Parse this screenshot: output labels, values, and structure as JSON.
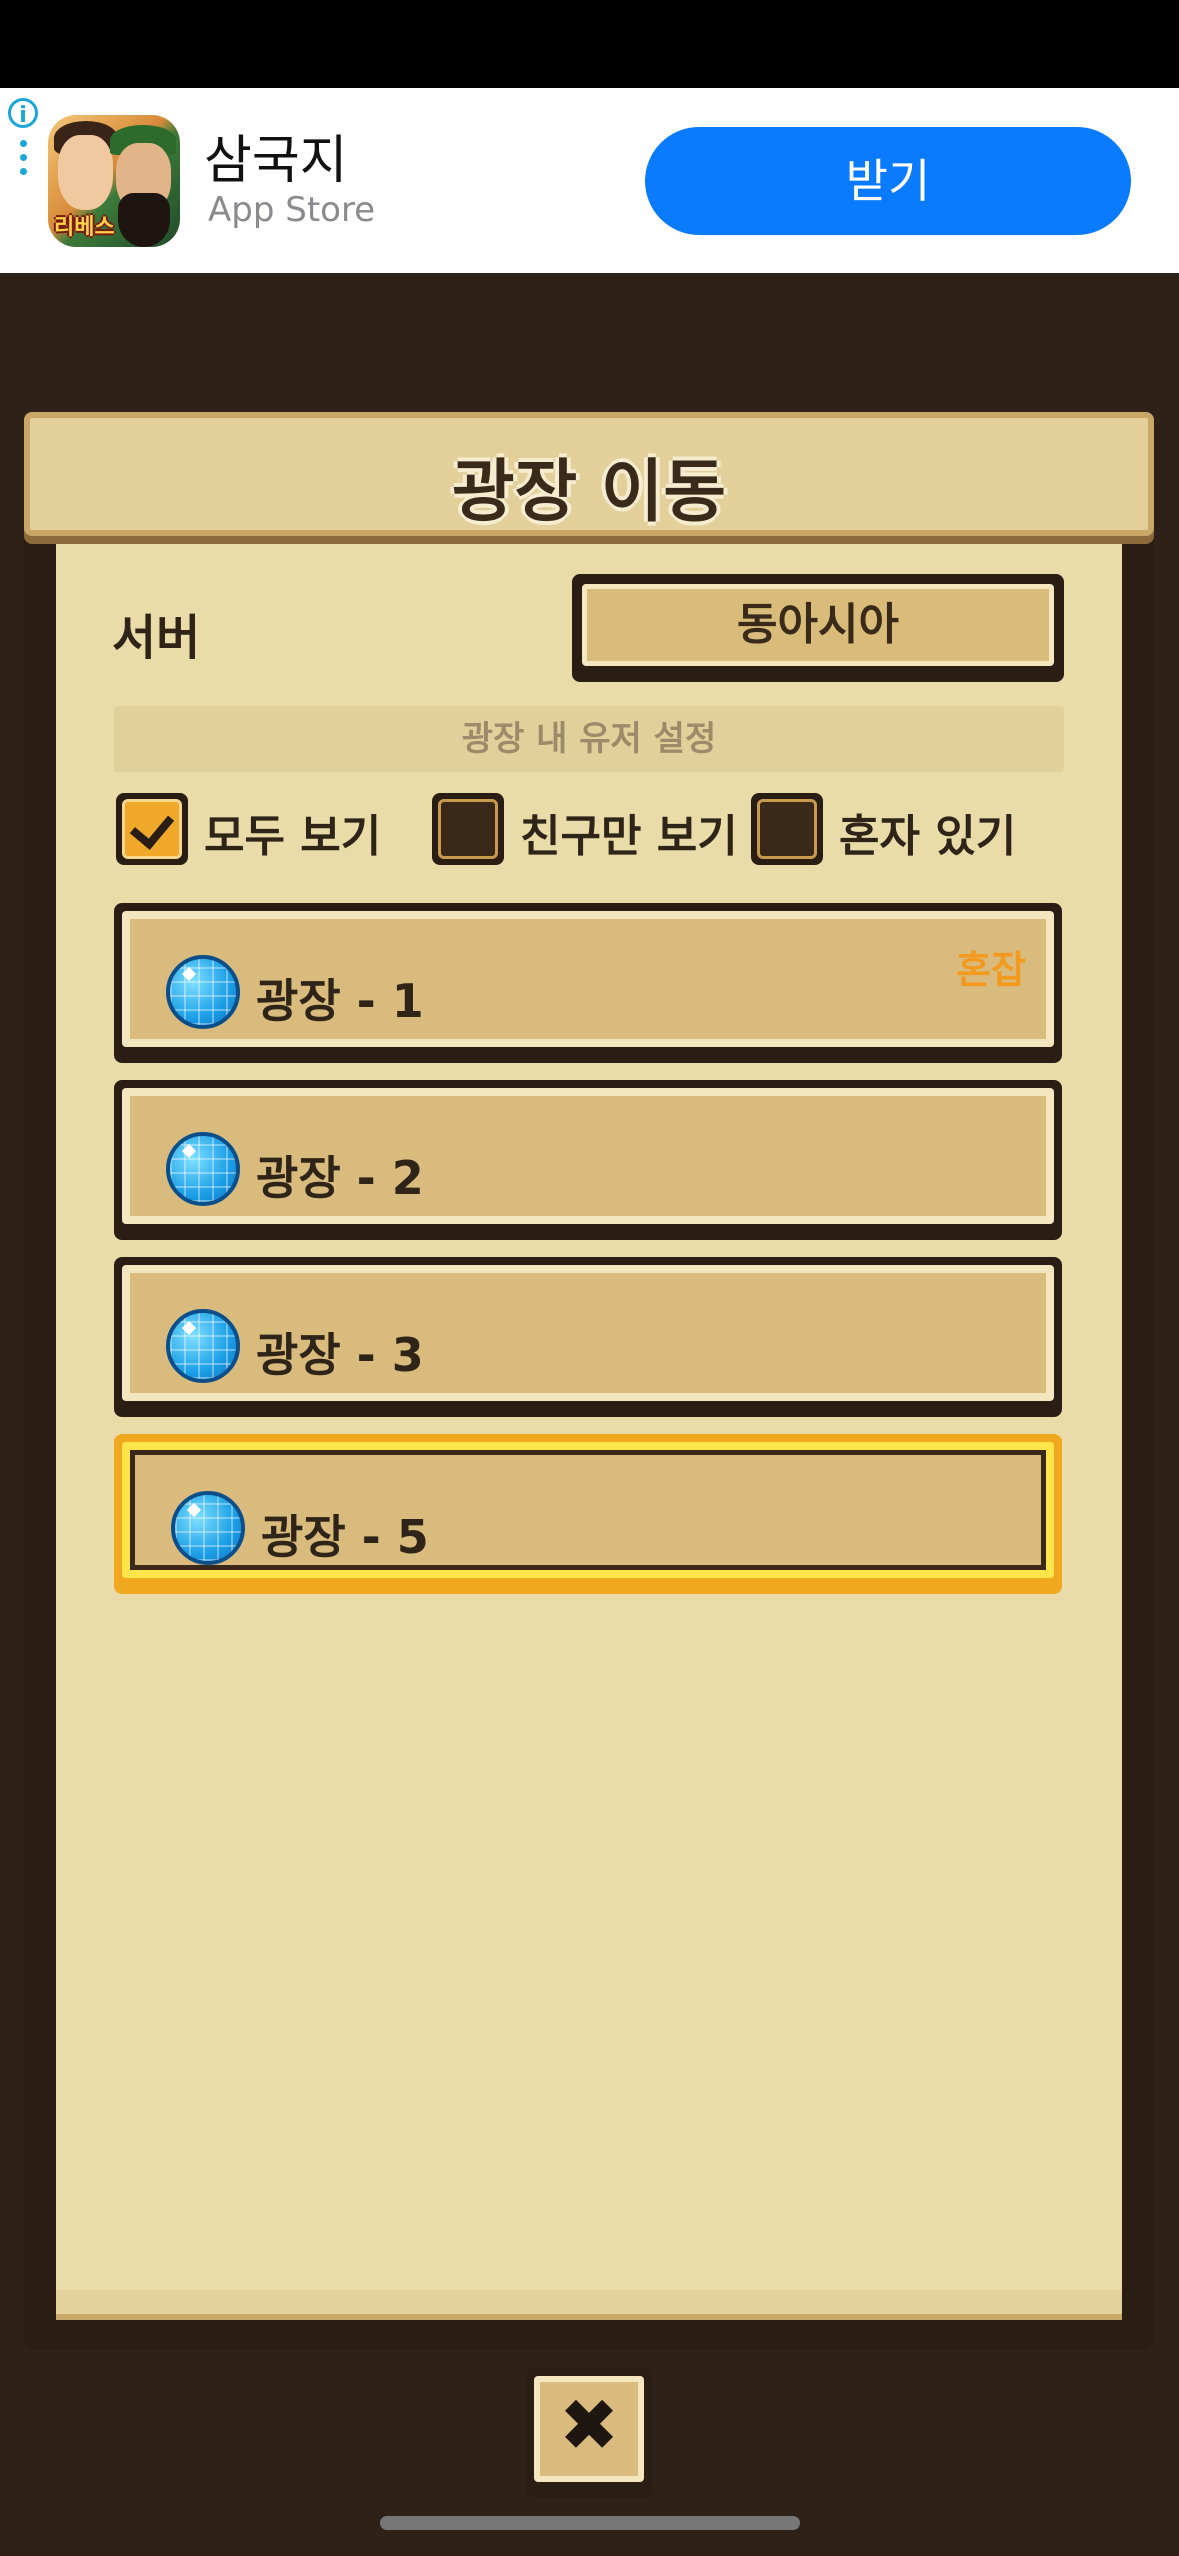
{
  "ad": {
    "app_name": "삼국지",
    "store": "App Store",
    "get_label": "받기",
    "icon_label": "리베스"
  },
  "dialog": {
    "title": "광장 이동",
    "server_label": "서버",
    "server_value": "동아시아",
    "user_setting_label": "광장 내 유저 설정",
    "filters": [
      {
        "label": "모두 보기",
        "checked": true
      },
      {
        "label": "친구만 보기",
        "checked": false
      },
      {
        "label": "혼자 있기",
        "checked": false
      }
    ],
    "rooms": [
      {
        "label": "광장 - 1",
        "badge": "혼잡",
        "selected": false
      },
      {
        "label": "광장 - 2",
        "badge": "",
        "selected": false
      },
      {
        "label": "광장 - 3",
        "badge": "",
        "selected": false
      },
      {
        "label": "광장 - 5",
        "badge": "",
        "selected": true
      }
    ],
    "close_symbol": "✖"
  },
  "colors": {
    "background": "#2e2118",
    "parchment": "#eadca8",
    "button": "#d9bb7a",
    "highlight": "#ffe54a",
    "badge": "#f39a1e",
    "ad_button": "#0a7bff"
  }
}
